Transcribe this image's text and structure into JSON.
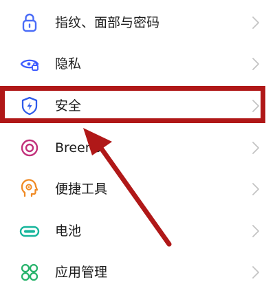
{
  "settings_list": {
    "items": [
      {
        "label": "指纹、面部与密码",
        "icon": "lock-icon",
        "color": "#4a6cf7"
      },
      {
        "label": "隐私",
        "icon": "privacy-eye-icon",
        "color": "#3d5afe"
      },
      {
        "label": "安全",
        "icon": "shield-icon",
        "color": "#2f5bea"
      },
      {
        "label": "Breeno",
        "icon": "breeno-icon",
        "color": "#c2307b"
      },
      {
        "label": "便捷工具",
        "icon": "convenience-tools-icon",
        "color": "#f08a24"
      },
      {
        "label": "电池",
        "icon": "battery-icon",
        "color": "#16b59b"
      },
      {
        "label": "应用管理",
        "icon": "app-management-icon",
        "color": "#27b36b"
      }
    ]
  },
  "annotation": {
    "highlight_color": "#b01818",
    "highlighted_item": "安全"
  }
}
